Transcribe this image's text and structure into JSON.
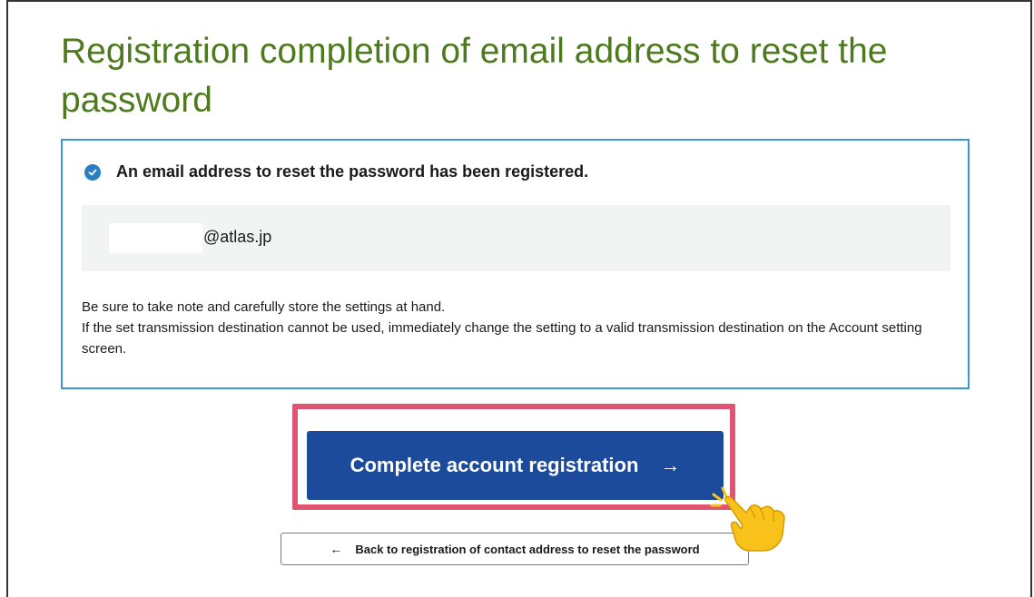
{
  "page": {
    "title": "Registration completion of email address to reset the password"
  },
  "panel": {
    "success_message": "An email address to reset the password has been registered.",
    "email_value": "@atlas.jp",
    "note_line1": "Be sure to take note and carefully store the settings at hand.",
    "note_line2": "If the set transmission destination cannot be used, immediately change the setting to a valid transmission destination on the Account setting screen."
  },
  "actions": {
    "primary_label": "Complete account registration",
    "primary_arrow": "→",
    "secondary_label": "Back to registration of contact address to reset the password",
    "secondary_arrow": "←"
  },
  "icons": {
    "success": "check-circle-icon",
    "pointer": "pointing-hand-icon"
  },
  "colors": {
    "title": "#4d7a1e",
    "panel_border": "#3a98d8",
    "primary_button": "#1d4b9c",
    "highlight": "#e05472",
    "check": "#2b7ec2"
  }
}
